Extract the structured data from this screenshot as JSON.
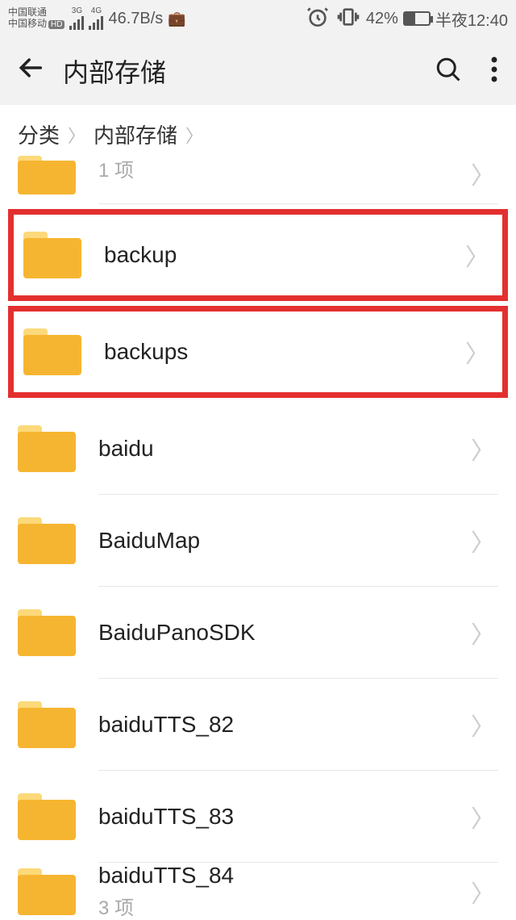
{
  "statusbar": {
    "carrier1": "中国联通",
    "carrier2": "中国移动",
    "hd": "HD",
    "net1": "3G",
    "net2": "4G",
    "speed": "46.7B/s",
    "battery_pct": "42%",
    "time": "半夜12:40"
  },
  "appbar": {
    "title": "内部存储"
  },
  "breadcrumb": {
    "items": [
      "分类",
      "内部存储"
    ]
  },
  "folders": {
    "partial_top_meta": "1 项",
    "backup": "backup",
    "backups": "backups",
    "baidu": "baidu",
    "baidumap": "BaiduMap",
    "baidupanosdk": "BaiduPanoSDK",
    "baidutts82": "baiduTTS_82",
    "baidutts83": "baiduTTS_83",
    "baidutts84": "baiduTTS_84",
    "partial_bottom_meta": "3 项"
  }
}
